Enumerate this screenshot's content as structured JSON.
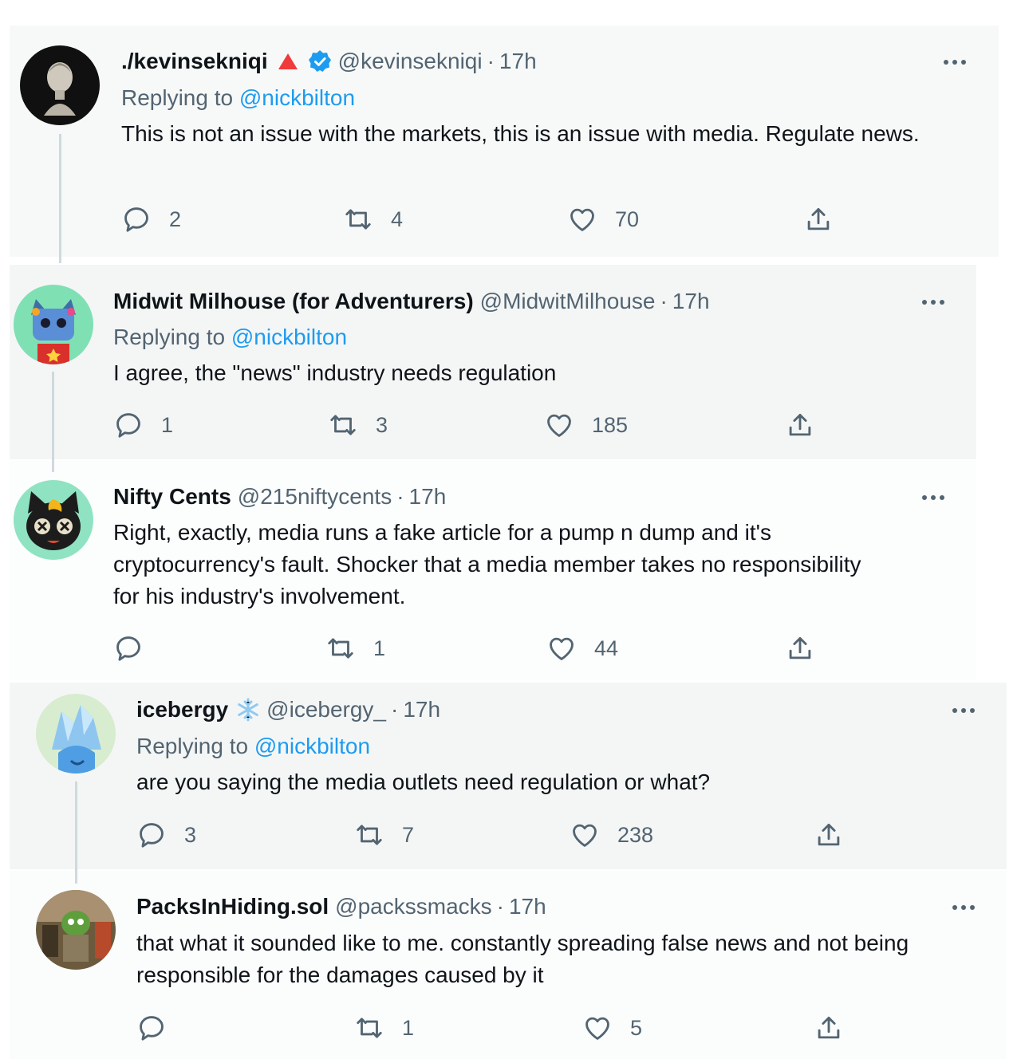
{
  "colors": {
    "accent": "#1d9bf0",
    "secondary_text": "#536471",
    "panel_bg": "#f7f9f9",
    "thread_line": "#cfd9de"
  },
  "tweets": [
    {
      "name": "./kevinsekniqi",
      "handle": "@kevinsekniqi",
      "sep": "·",
      "time": "17h",
      "badges": [
        "red-triangle-icon",
        "verified-badge-icon"
      ],
      "replying_prefix": "Replying to",
      "replying_to": "@nickbilton",
      "text": "This is not an issue with the markets, this is an issue with media. Regulate news.",
      "replies": "2",
      "retweets": "4",
      "likes": "70"
    },
    {
      "name": "Midwit Milhouse (for Adventurers)",
      "handle": "@MidwitMilhouse",
      "sep": "·",
      "time": "17h",
      "replying_prefix": "Replying to",
      "replying_to": "@nickbilton",
      "text": "I agree, the \"news\" industry needs regulation",
      "replies": "1",
      "retweets": "3",
      "likes": "185"
    },
    {
      "name": "Nifty Cents",
      "handle": "@215niftycents",
      "sep": "·",
      "time": "17h",
      "text": "Right, exactly, media runs a fake article for a pump n dump and it's cryptocurrency's fault.  Shocker that a media member takes no responsibility for his industry's involvement.",
      "replies": "",
      "retweets": "1",
      "likes": "44"
    },
    {
      "name": "icebergy",
      "handle": "@icebergy_",
      "sep": "·",
      "time": "17h",
      "badges": [
        "snowflake-icon"
      ],
      "replying_prefix": "Replying to",
      "replying_to": "@nickbilton",
      "text": "are you saying the media outlets need regulation or what?",
      "replies": "3",
      "retweets": "7",
      "likes": "238"
    },
    {
      "name": "PacksInHiding.sol",
      "handle": "@packssmacks",
      "sep": "·",
      "time": "17h",
      "text": "that what it sounded like to me. constantly spreading false news and not being responsible for the damages caused by it",
      "replies": "",
      "retweets": "1",
      "likes": "5"
    }
  ]
}
